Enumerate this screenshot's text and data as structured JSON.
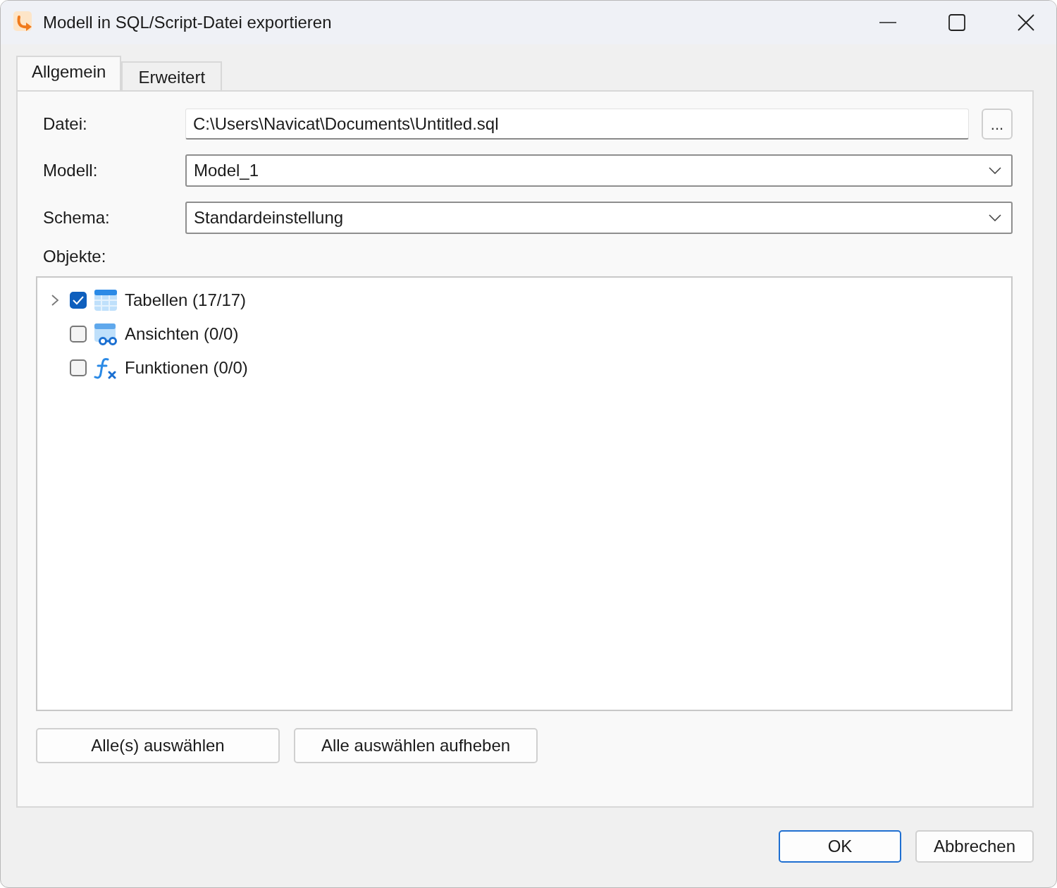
{
  "window": {
    "title": "Modell in SQL/Script-Datei exportieren"
  },
  "tabs": [
    {
      "label": "Allgemein",
      "selected": true
    },
    {
      "label": "Erweitert",
      "selected": false
    }
  ],
  "form": {
    "file": {
      "label": "Datei:",
      "value": "C:\\Users\\Navicat\\Documents\\Untitled.sql",
      "browse": "..."
    },
    "model": {
      "label": "Modell:",
      "value": "Model_1"
    },
    "schema": {
      "label": "Schema:",
      "value": "Standardeinstellung"
    },
    "objects_label": "Objekte:"
  },
  "objects": [
    {
      "kind": "table",
      "label": "Tabellen (17/17)",
      "checked": true,
      "expandable": true
    },
    {
      "kind": "view",
      "label": "Ansichten (0/0)",
      "checked": false,
      "expandable": false
    },
    {
      "kind": "function",
      "label": "Funktionen (0/0)",
      "checked": false,
      "expandable": false
    }
  ],
  "panel_buttons": [
    "Alle(s) auswählen",
    "Alle auswählen aufheben"
  ],
  "dialog_buttons": [
    {
      "label": "OK",
      "default": true
    },
    {
      "label": "Abbrechen",
      "default": false
    }
  ]
}
